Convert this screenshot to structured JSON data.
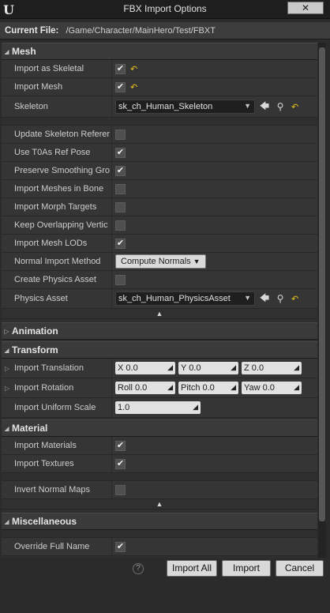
{
  "window": {
    "title": "FBX Import Options",
    "close_label": "✕"
  },
  "current_file": {
    "label": "Current File:",
    "value": "/Game/Character/MainHero/Test/FBXT"
  },
  "mesh": {
    "title": "Mesh",
    "import_as_skeletal": "Import as Skeletal",
    "import_mesh": "Import Mesh",
    "skeleton": "Skeleton",
    "skeleton_value": "sk_ch_Human_Skeleton",
    "update_skeleton": "Update Skeleton Referer",
    "use_t0as": "Use T0As Ref Pose",
    "preserve_smoothing": "Preserve Smoothing Gro",
    "import_meshes_in_bone": "Import Meshes in Bone",
    "import_morph": "Import Morph Targets",
    "keep_overlapping": "Keep Overlapping Vertic",
    "import_mesh_lods": "Import Mesh LODs",
    "normal_import_method": "Normal Import Method",
    "normal_import_value": "Compute Normals",
    "create_physics_asset": "Create Physics Asset",
    "physics_asset": "Physics Asset",
    "physics_asset_value": "sk_ch_Human_PhysicsAsset"
  },
  "animation": {
    "title": "Animation"
  },
  "transform": {
    "title": "Transform",
    "import_translation": "Import Translation",
    "translation": {
      "x": "X  0.0",
      "y": "Y  0.0",
      "z": "Z  0.0"
    },
    "import_rotation": "Import Rotation",
    "rotation": {
      "roll": "Roll  0.0",
      "pitch": "Pitch  0.0",
      "yaw": "Yaw  0.0"
    },
    "import_uniform_scale": "Import Uniform Scale",
    "uniform_scale": "1.0"
  },
  "material": {
    "title": "Material",
    "import_materials": "Import Materials",
    "import_textures": "Import Textures",
    "invert_normal_maps": "Invert Normal Maps"
  },
  "misc": {
    "title": "Miscellaneous",
    "override_full_name": "Override Full Name"
  },
  "buttons": {
    "import_all": "Import All",
    "import": "Import",
    "cancel": "Cancel",
    "help": "?"
  },
  "colors": {
    "reset_arrow": "#e6c21a",
    "background": "#2b2b2b"
  }
}
